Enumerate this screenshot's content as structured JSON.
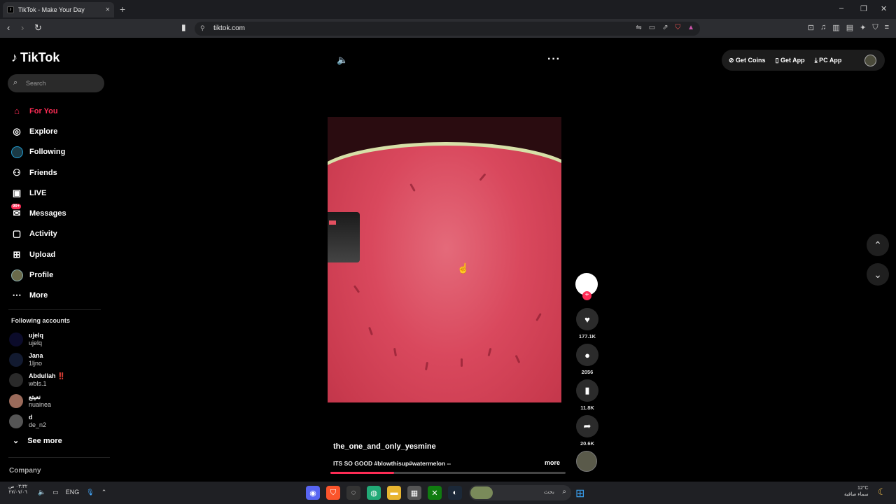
{
  "browser": {
    "tab_title": "TikTok - Make Your Day",
    "tab_close": "×",
    "new_tab": "+",
    "url": "tiktok.com",
    "win_minimize": "–",
    "win_restore": "❐",
    "win_close": "✕"
  },
  "sidebar": {
    "logo": "TikTok",
    "search_placeholder": "Search",
    "nav": [
      {
        "label": "For You"
      },
      {
        "label": "Explore"
      },
      {
        "label": "Following"
      },
      {
        "label": "Friends"
      },
      {
        "label": "LIVE"
      },
      {
        "label": "Messages",
        "badge": "99+"
      },
      {
        "label": "Activity"
      },
      {
        "label": "Upload"
      },
      {
        "label": "Profile"
      },
      {
        "label": "More"
      }
    ],
    "following_title": "Following accounts",
    "accounts": [
      {
        "name": "ujelq",
        "handle": "ujelq"
      },
      {
        "name": "Jana",
        "handle": "1ljno"
      },
      {
        "name": "Abdullah ‼️",
        "handle": "wbls.1"
      },
      {
        "name": "نعيتع",
        "handle": "nuainea"
      },
      {
        "name": "d",
        "handle": "de_n2"
      }
    ],
    "see_more": "See more",
    "company": "Company"
  },
  "video": {
    "author": "the_one_and_only_yesmine",
    "caption": "ITS SO GOOD #blowthisup#watermelon --",
    "more": "more",
    "progress": 0.27
  },
  "actions": {
    "likes": "177.1K",
    "comments": "2056",
    "saves": "11.8K",
    "shares": "20.6K"
  },
  "topbar": {
    "get_coins": "Get Coins",
    "get_app": "Get App",
    "pc_app": "PC App"
  },
  "taskbar": {
    "time": "٠٣:٣٢ ص",
    "date": "٢٧/٠٧/٠٦",
    "lang": "ENG",
    "search_text": "بحث",
    "temp": "12°C",
    "weather": "سماء صافية"
  },
  "colors": {
    "accent": "#fe2c55",
    "background": "#000000"
  }
}
